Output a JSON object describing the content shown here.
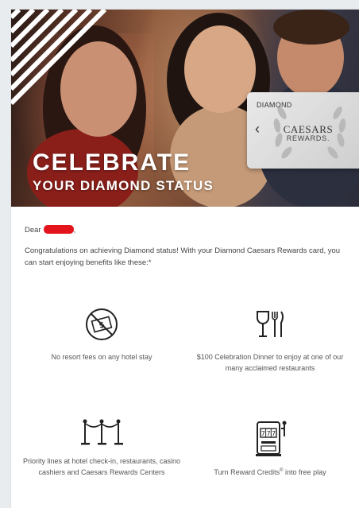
{
  "hero": {
    "title": "CELEBRATE",
    "subtitle": "YOUR DIAMOND STATUS",
    "card": {
      "tier": "DIAMOND",
      "brand": "CAESARS",
      "program": "REWARDS."
    }
  },
  "greeting": {
    "prefix": "Dear",
    "suffix": ","
  },
  "intro": "Congratulations on achieving Diamond status! With your Diamond Caesars Rewards card, you can start enjoying benefits like these:*",
  "benefits": [
    {
      "icon": "no-resort-fee-icon",
      "text": "No resort fees on any hotel stay"
    },
    {
      "icon": "dining-icon",
      "text": "$100 Celebration Dinner to enjoy at one of our many acclaimed restaurants"
    },
    {
      "icon": "stanchion-icon",
      "text": "Priority lines at hotel check-in, restaurants, casino cashiers and Caesars Rewards Centers"
    },
    {
      "icon": "slot-machine-icon",
      "text_before": "Turn Reward Credits",
      "text_sup": "®",
      "text_after": " into free play"
    }
  ]
}
